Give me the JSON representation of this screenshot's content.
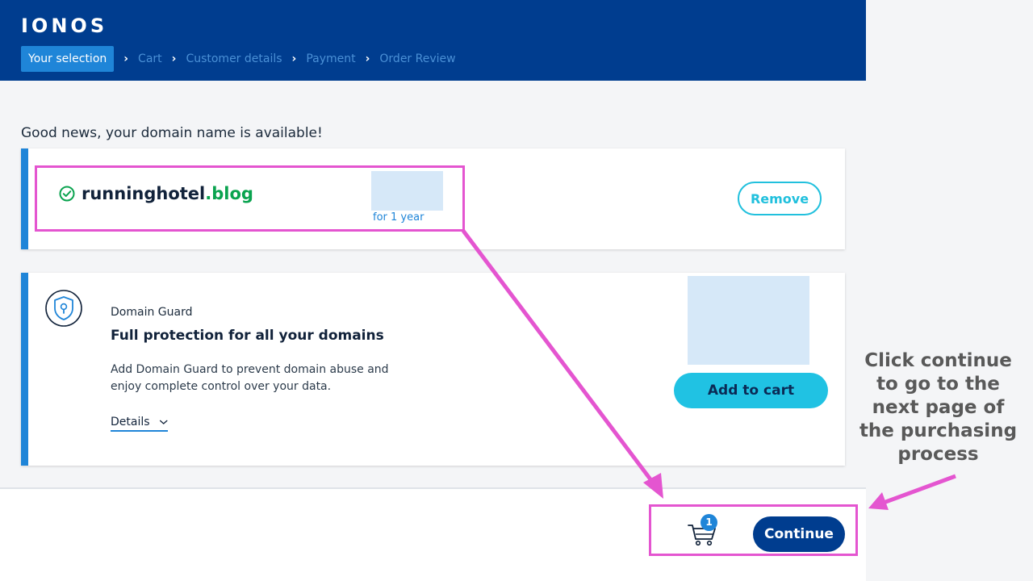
{
  "header": {
    "logo": "IONOS",
    "breadcrumb": [
      "Your selection",
      "Cart",
      "Customer details",
      "Payment",
      "Order Review"
    ],
    "active_step": "Your selection"
  },
  "main": {
    "notice": "Good news, your domain name is available!",
    "domain_card": {
      "domain_name": "runninghotel",
      "domain_tld": ".blog",
      "term": "for 1 year",
      "remove_label": "Remove"
    },
    "guard_card": {
      "kicker": "Domain Guard",
      "title": "Full protection for all your domains",
      "description": "Add Domain Guard to prevent domain abuse and enjoy complete control over your data.",
      "details_label": "Details",
      "add_label": "Add to cart"
    }
  },
  "footer": {
    "cart_count": "1",
    "continue_label": "Continue"
  },
  "annotation": {
    "callout": "Click continue to go to the next page of the purchasing process"
  },
  "colors": {
    "header_bg": "#003d8f",
    "accent_blue": "#1f85d8",
    "cyan": "#20c2e3",
    "success_green": "#0aa34f",
    "highlight_magenta": "#e455d0"
  },
  "icons": [
    "check-circle-icon",
    "shield-lock-icon",
    "chevron-down-icon",
    "cart-icon"
  ]
}
